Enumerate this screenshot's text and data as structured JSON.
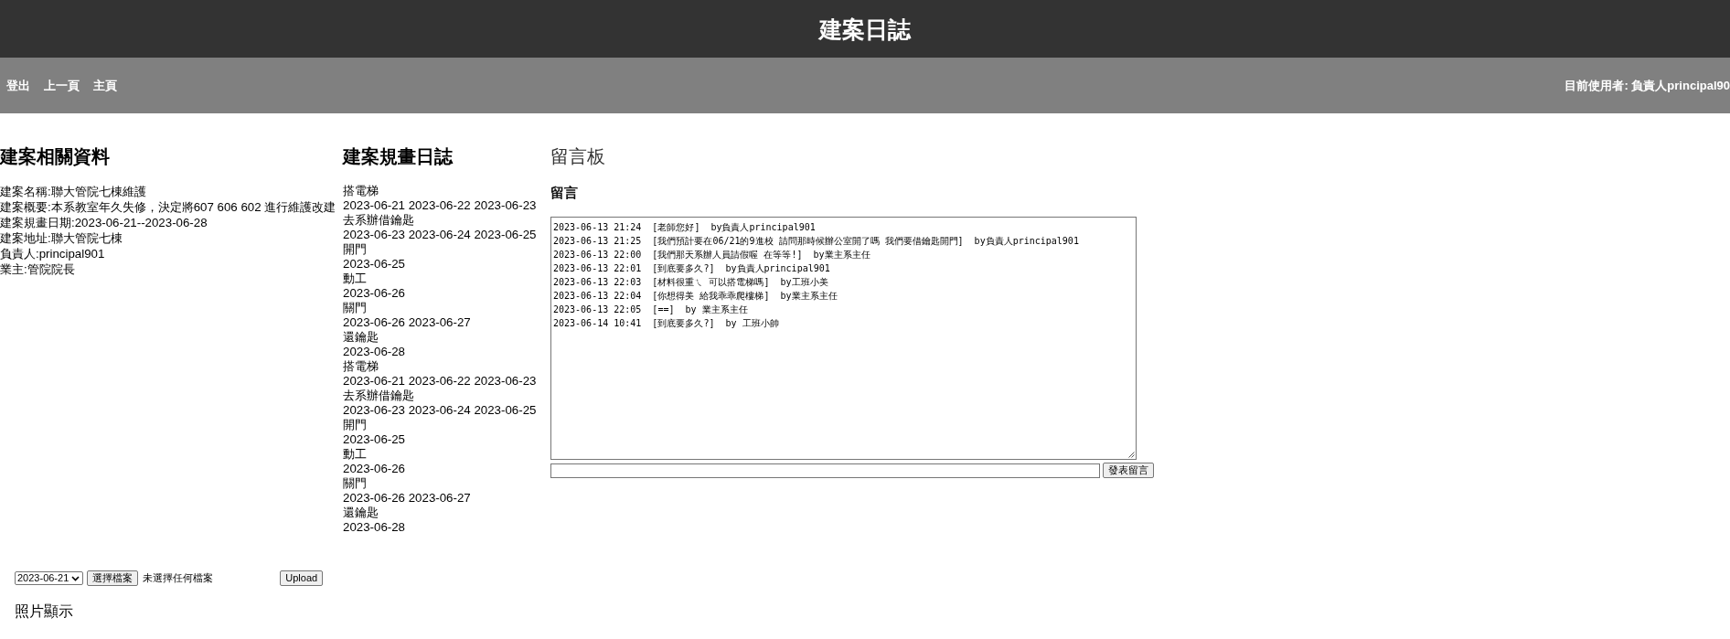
{
  "header": {
    "title": "建案日誌"
  },
  "nav": {
    "links": [
      {
        "label": "登出"
      },
      {
        "label": "上一頁"
      },
      {
        "label": "主頁"
      }
    ],
    "current_user": "目前使用者: 負責人principal90"
  },
  "project_info": {
    "heading": "建案相關資料",
    "fields": [
      "建案名稱:聯大管院七棟維護",
      "建案概要:本系教室年久失修，決定將607 606 602 進行維護改建",
      "建案規畫日期:2023-06-21--2023-06-28",
      "建案地址:聯大管院七棟",
      "負責人:principal901",
      "業主:管院院長"
    ]
  },
  "plan_log": {
    "heading": "建案規畫日誌",
    "entries": [
      {
        "task": "搭電梯",
        "dates": "2023-06-21 2023-06-22 2023-06-23"
      },
      {
        "task": "去系辦借鑰匙",
        "dates": "2023-06-23 2023-06-24 2023-06-25"
      },
      {
        "task": "開門",
        "dates": "2023-06-25"
      },
      {
        "task": "動工",
        "dates": "2023-06-26"
      },
      {
        "task": "關門",
        "dates": "2023-06-26 2023-06-27"
      },
      {
        "task": "還鑰匙",
        "dates": "2023-06-28"
      },
      {
        "task": "搭電梯",
        "dates": "2023-06-21 2023-06-22 2023-06-23"
      },
      {
        "task": "去系辦借鑰匙",
        "dates": "2023-06-23 2023-06-24 2023-06-25"
      },
      {
        "task": "開門",
        "dates": "2023-06-25"
      },
      {
        "task": "動工",
        "dates": "2023-06-26"
      },
      {
        "task": "關門",
        "dates": "2023-06-26 2023-06-27"
      },
      {
        "task": "還鑰匙",
        "dates": "2023-06-28"
      }
    ]
  },
  "message_board": {
    "heading": "留言板",
    "subheading": "留言",
    "messages": [
      "2023-06-13 21:24  [老師您好]  by負責人principal901",
      "2023-06-13 21:25  [我們預計要在06/21的9進校 請問那時候辦公室開了嗎 我們要借鑰匙開門]  by負責人principal901",
      "2023-06-13 22:00  [我們那天系辦人員請假喔 在等等!]  by業主系主任",
      "2023-06-13 22:01  [到底要多久?]  by負責人principal901",
      "2023-06-13 22:03  [材料很重ㄟ 可以搭電梯嗎]  by工班小美",
      "2023-06-13 22:04  [你想得美 給我乖乖爬樓梯]  by業主系主任",
      "2023-06-13 22:05  [==]  by 業主系主任",
      "2023-06-14 10:41  [到底要多久?]  by 工班小帥"
    ],
    "submit_button": "發表留言"
  },
  "upload": {
    "date_select": "2023-06-21",
    "file_button": "選擇檔案",
    "file_status": "未選擇任何檔案",
    "upload_button": "Upload"
  },
  "photos": {
    "heading": "照片顯示"
  }
}
